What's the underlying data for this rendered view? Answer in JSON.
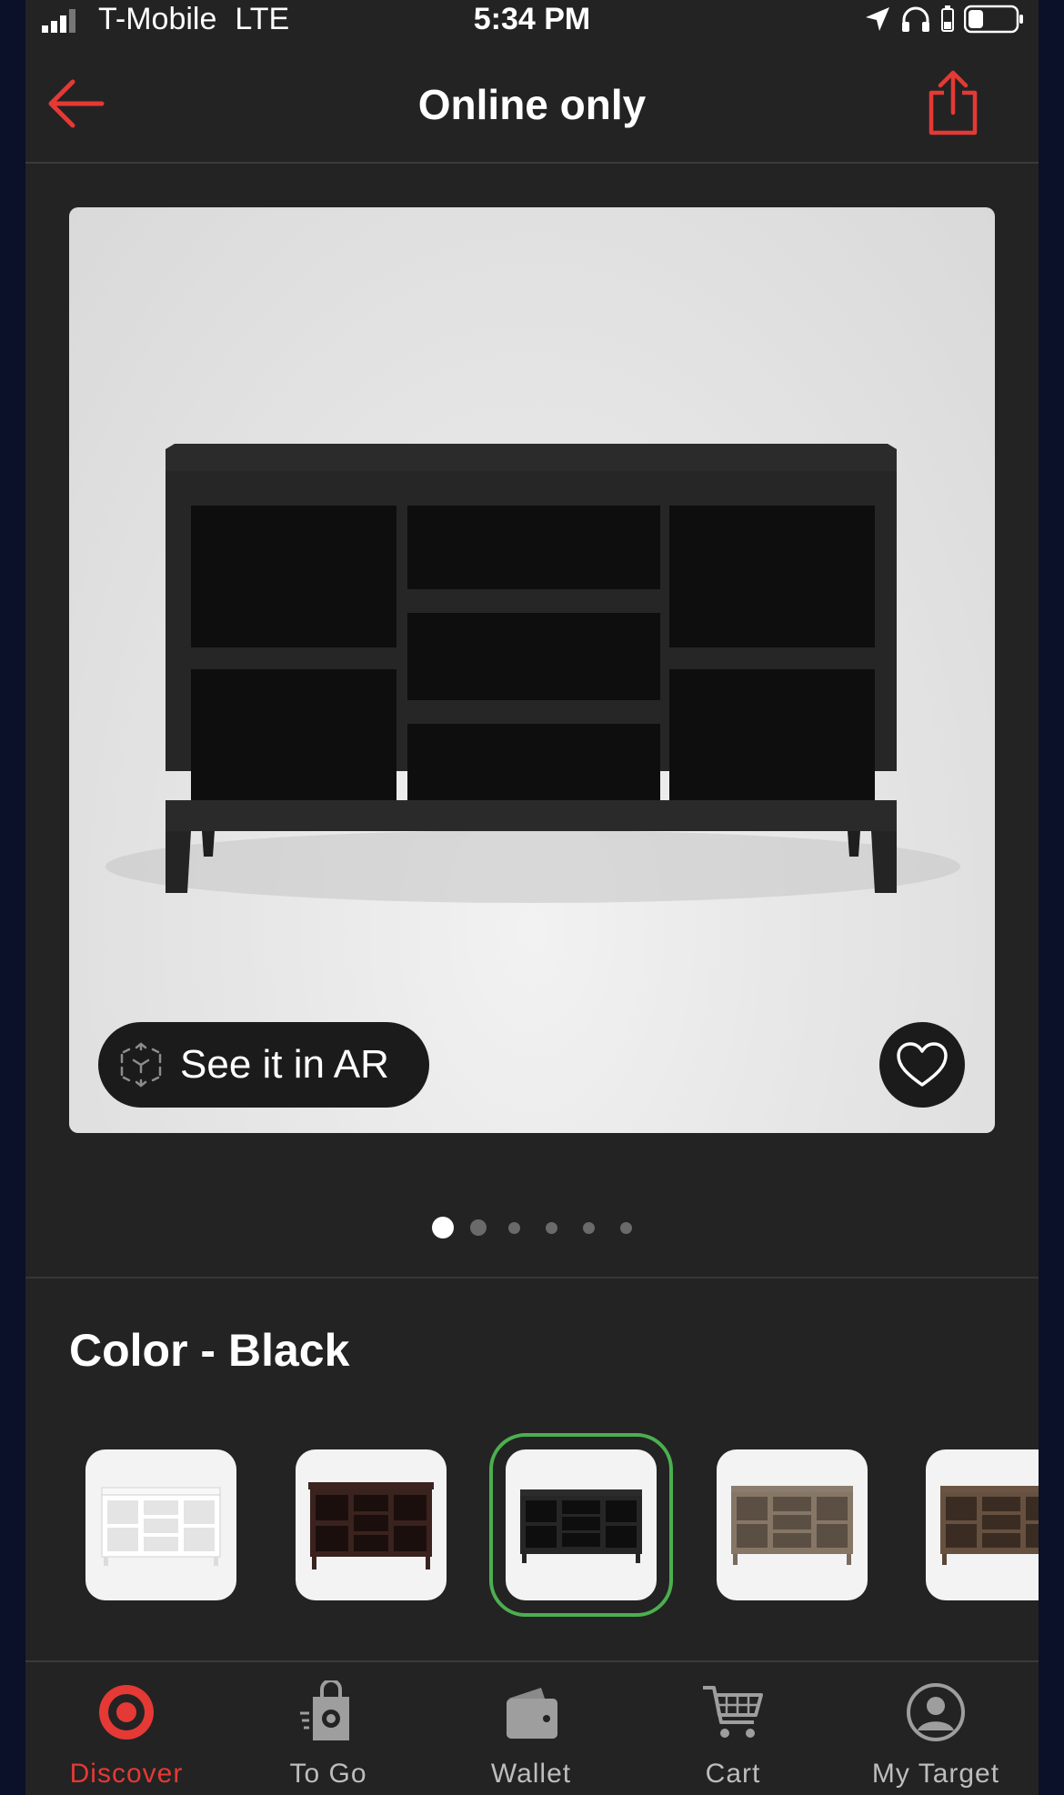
{
  "status_bar": {
    "carrier": "T-Mobile",
    "network": "LTE",
    "time": "5:34 PM"
  },
  "header": {
    "title": "Online only",
    "back_icon": "arrow-left-icon",
    "share_icon": "share-icon"
  },
  "product_image": {
    "ar_label": "See it in AR",
    "ar_icon": "ar-cube-icon",
    "favorite_icon": "heart-icon"
  },
  "carousel": {
    "total_dots": 6,
    "active_index": 0
  },
  "color": {
    "title": "Color - Black",
    "swatches": [
      {
        "name": "white",
        "selected": false
      },
      {
        "name": "espresso",
        "selected": false
      },
      {
        "name": "black",
        "selected": true
      },
      {
        "name": "gray-wash",
        "selected": false
      },
      {
        "name": "brown-wash",
        "selected": false
      }
    ]
  },
  "nav": {
    "items": [
      {
        "label": "Discover",
        "icon": "target-icon",
        "active": true
      },
      {
        "label": "To Go",
        "icon": "to-go-bag-icon",
        "active": false
      },
      {
        "label": "Wallet",
        "icon": "wallet-icon",
        "active": false
      },
      {
        "label": "Cart",
        "icon": "cart-icon",
        "active": false
      },
      {
        "label": "My Target",
        "icon": "user-icon",
        "active": false
      }
    ]
  },
  "colors": {
    "accent": "#e53935",
    "background": "#232323",
    "selected_outline": "#4caf50"
  }
}
